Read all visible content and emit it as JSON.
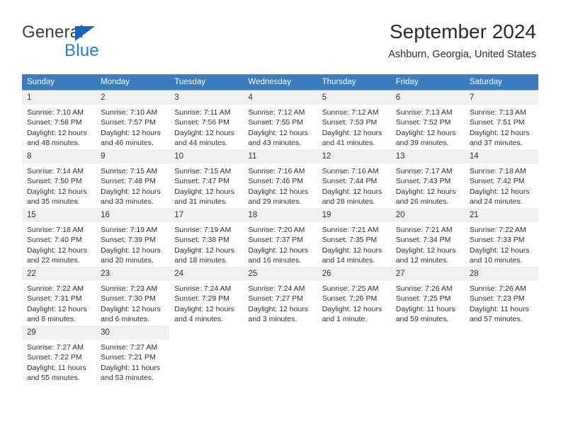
{
  "brand": {
    "name_part1": "General",
    "name_part2": "Blue",
    "triangle_color": "#1565b8",
    "blue_color": "#1f7fd4"
  },
  "header": {
    "title": "September 2024",
    "subtitle": "Ashburn, Georgia, United States",
    "header_bg_color": "#3a7cbe",
    "day_band_color": "#f0f0f0"
  },
  "weekdays": [
    "Sunday",
    "Monday",
    "Tuesday",
    "Wednesday",
    "Thursday",
    "Friday",
    "Saturday"
  ],
  "labels": {
    "sunrise": "Sunrise:",
    "sunset": "Sunset:",
    "daylight": "Daylight:"
  },
  "weeks": [
    [
      {
        "day": "1",
        "sunrise": "Sunrise: 7:10 AM",
        "sunset": "Sunset: 7:58 PM",
        "daylight_1": "Daylight: 12 hours",
        "daylight_2": "and 48 minutes."
      },
      {
        "day": "2",
        "sunrise": "Sunrise: 7:10 AM",
        "sunset": "Sunset: 7:57 PM",
        "daylight_1": "Daylight: 12 hours",
        "daylight_2": "and 46 minutes."
      },
      {
        "day": "3",
        "sunrise": "Sunrise: 7:11 AM",
        "sunset": "Sunset: 7:56 PM",
        "daylight_1": "Daylight: 12 hours",
        "daylight_2": "and 44 minutes."
      },
      {
        "day": "4",
        "sunrise": "Sunrise: 7:12 AM",
        "sunset": "Sunset: 7:55 PM",
        "daylight_1": "Daylight: 12 hours",
        "daylight_2": "and 43 minutes."
      },
      {
        "day": "5",
        "sunrise": "Sunrise: 7:12 AM",
        "sunset": "Sunset: 7:53 PM",
        "daylight_1": "Daylight: 12 hours",
        "daylight_2": "and 41 minutes."
      },
      {
        "day": "6",
        "sunrise": "Sunrise: 7:13 AM",
        "sunset": "Sunset: 7:52 PM",
        "daylight_1": "Daylight: 12 hours",
        "daylight_2": "and 39 minutes."
      },
      {
        "day": "7",
        "sunrise": "Sunrise: 7:13 AM",
        "sunset": "Sunset: 7:51 PM",
        "daylight_1": "Daylight: 12 hours",
        "daylight_2": "and 37 minutes."
      }
    ],
    [
      {
        "day": "8",
        "sunrise": "Sunrise: 7:14 AM",
        "sunset": "Sunset: 7:50 PM",
        "daylight_1": "Daylight: 12 hours",
        "daylight_2": "and 35 minutes."
      },
      {
        "day": "9",
        "sunrise": "Sunrise: 7:15 AM",
        "sunset": "Sunset: 7:48 PM",
        "daylight_1": "Daylight: 12 hours",
        "daylight_2": "and 33 minutes."
      },
      {
        "day": "10",
        "sunrise": "Sunrise: 7:15 AM",
        "sunset": "Sunset: 7:47 PM",
        "daylight_1": "Daylight: 12 hours",
        "daylight_2": "and 31 minutes."
      },
      {
        "day": "11",
        "sunrise": "Sunrise: 7:16 AM",
        "sunset": "Sunset: 7:46 PM",
        "daylight_1": "Daylight: 12 hours",
        "daylight_2": "and 29 minutes."
      },
      {
        "day": "12",
        "sunrise": "Sunrise: 7:16 AM",
        "sunset": "Sunset: 7:44 PM",
        "daylight_1": "Daylight: 12 hours",
        "daylight_2": "and 28 minutes."
      },
      {
        "day": "13",
        "sunrise": "Sunrise: 7:17 AM",
        "sunset": "Sunset: 7:43 PM",
        "daylight_1": "Daylight: 12 hours",
        "daylight_2": "and 26 minutes."
      },
      {
        "day": "14",
        "sunrise": "Sunrise: 7:18 AM",
        "sunset": "Sunset: 7:42 PM",
        "daylight_1": "Daylight: 12 hours",
        "daylight_2": "and 24 minutes."
      }
    ],
    [
      {
        "day": "15",
        "sunrise": "Sunrise: 7:18 AM",
        "sunset": "Sunset: 7:40 PM",
        "daylight_1": "Daylight: 12 hours",
        "daylight_2": "and 22 minutes."
      },
      {
        "day": "16",
        "sunrise": "Sunrise: 7:19 AM",
        "sunset": "Sunset: 7:39 PM",
        "daylight_1": "Daylight: 12 hours",
        "daylight_2": "and 20 minutes."
      },
      {
        "day": "17",
        "sunrise": "Sunrise: 7:19 AM",
        "sunset": "Sunset: 7:38 PM",
        "daylight_1": "Daylight: 12 hours",
        "daylight_2": "and 18 minutes."
      },
      {
        "day": "18",
        "sunrise": "Sunrise: 7:20 AM",
        "sunset": "Sunset: 7:37 PM",
        "daylight_1": "Daylight: 12 hours",
        "daylight_2": "and 16 minutes."
      },
      {
        "day": "19",
        "sunrise": "Sunrise: 7:21 AM",
        "sunset": "Sunset: 7:35 PM",
        "daylight_1": "Daylight: 12 hours",
        "daylight_2": "and 14 minutes."
      },
      {
        "day": "20",
        "sunrise": "Sunrise: 7:21 AM",
        "sunset": "Sunset: 7:34 PM",
        "daylight_1": "Daylight: 12 hours",
        "daylight_2": "and 12 minutes."
      },
      {
        "day": "21",
        "sunrise": "Sunrise: 7:22 AM",
        "sunset": "Sunset: 7:33 PM",
        "daylight_1": "Daylight: 12 hours",
        "daylight_2": "and 10 minutes."
      }
    ],
    [
      {
        "day": "22",
        "sunrise": "Sunrise: 7:22 AM",
        "sunset": "Sunset: 7:31 PM",
        "daylight_1": "Daylight: 12 hours",
        "daylight_2": "and 8 minutes."
      },
      {
        "day": "23",
        "sunrise": "Sunrise: 7:23 AM",
        "sunset": "Sunset: 7:30 PM",
        "daylight_1": "Daylight: 12 hours",
        "daylight_2": "and 6 minutes."
      },
      {
        "day": "24",
        "sunrise": "Sunrise: 7:24 AM",
        "sunset": "Sunset: 7:29 PM",
        "daylight_1": "Daylight: 12 hours",
        "daylight_2": "and 4 minutes."
      },
      {
        "day": "25",
        "sunrise": "Sunrise: 7:24 AM",
        "sunset": "Sunset: 7:27 PM",
        "daylight_1": "Daylight: 12 hours",
        "daylight_2": "and 3 minutes."
      },
      {
        "day": "26",
        "sunrise": "Sunrise: 7:25 AM",
        "sunset": "Sunset: 7:26 PM",
        "daylight_1": "Daylight: 12 hours",
        "daylight_2": "and 1 minute."
      },
      {
        "day": "27",
        "sunrise": "Sunrise: 7:26 AM",
        "sunset": "Sunset: 7:25 PM",
        "daylight_1": "Daylight: 11 hours",
        "daylight_2": "and 59 minutes."
      },
      {
        "day": "28",
        "sunrise": "Sunrise: 7:26 AM",
        "sunset": "Sunset: 7:23 PM",
        "daylight_1": "Daylight: 11 hours",
        "daylight_2": "and 57 minutes."
      }
    ],
    [
      {
        "day": "29",
        "sunrise": "Sunrise: 7:27 AM",
        "sunset": "Sunset: 7:22 PM",
        "daylight_1": "Daylight: 11 hours",
        "daylight_2": "and 55 minutes."
      },
      {
        "day": "30",
        "sunrise": "Sunrise: 7:27 AM",
        "sunset": "Sunset: 7:21 PM",
        "daylight_1": "Daylight: 11 hours",
        "daylight_2": "and 53 minutes."
      },
      {
        "day": "",
        "sunrise": "",
        "sunset": "",
        "daylight_1": "",
        "daylight_2": ""
      },
      {
        "day": "",
        "sunrise": "",
        "sunset": "",
        "daylight_1": "",
        "daylight_2": ""
      },
      {
        "day": "",
        "sunrise": "",
        "sunset": "",
        "daylight_1": "",
        "daylight_2": ""
      },
      {
        "day": "",
        "sunrise": "",
        "sunset": "",
        "daylight_1": "",
        "daylight_2": ""
      },
      {
        "day": "",
        "sunrise": "",
        "sunset": "",
        "daylight_1": "",
        "daylight_2": ""
      }
    ]
  ]
}
